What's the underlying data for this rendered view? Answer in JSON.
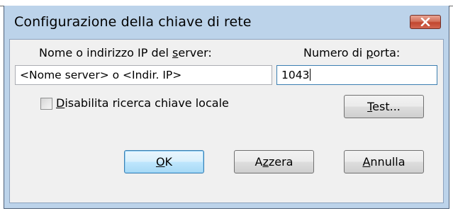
{
  "window": {
    "title": "Configurazione della chiave di rete"
  },
  "server": {
    "label_pre": "Nome o indirizzo IP del ",
    "label_key": "s",
    "label_post": "erver:",
    "value": "<Nome server> o <Indir. IP>"
  },
  "port": {
    "label_pre": "Numero di ",
    "label_key": "p",
    "label_post": "orta:",
    "value": "1043"
  },
  "local_search": {
    "label_key": "D",
    "label_post": "isabilita ricerca chiave locale",
    "checked": false
  },
  "buttons": {
    "test_key": "T",
    "test_post": "est...",
    "ok_key": "O",
    "ok_post": "K",
    "reset_pre": "A",
    "reset_key": "z",
    "reset_post": "zera",
    "cancel_key": "A",
    "cancel_post": "nnulla"
  },
  "colors": {
    "frame": "#bcd3ea",
    "client": "#f0f0f0",
    "close_button": "#c2472f",
    "default_button": "#bee6fd"
  }
}
